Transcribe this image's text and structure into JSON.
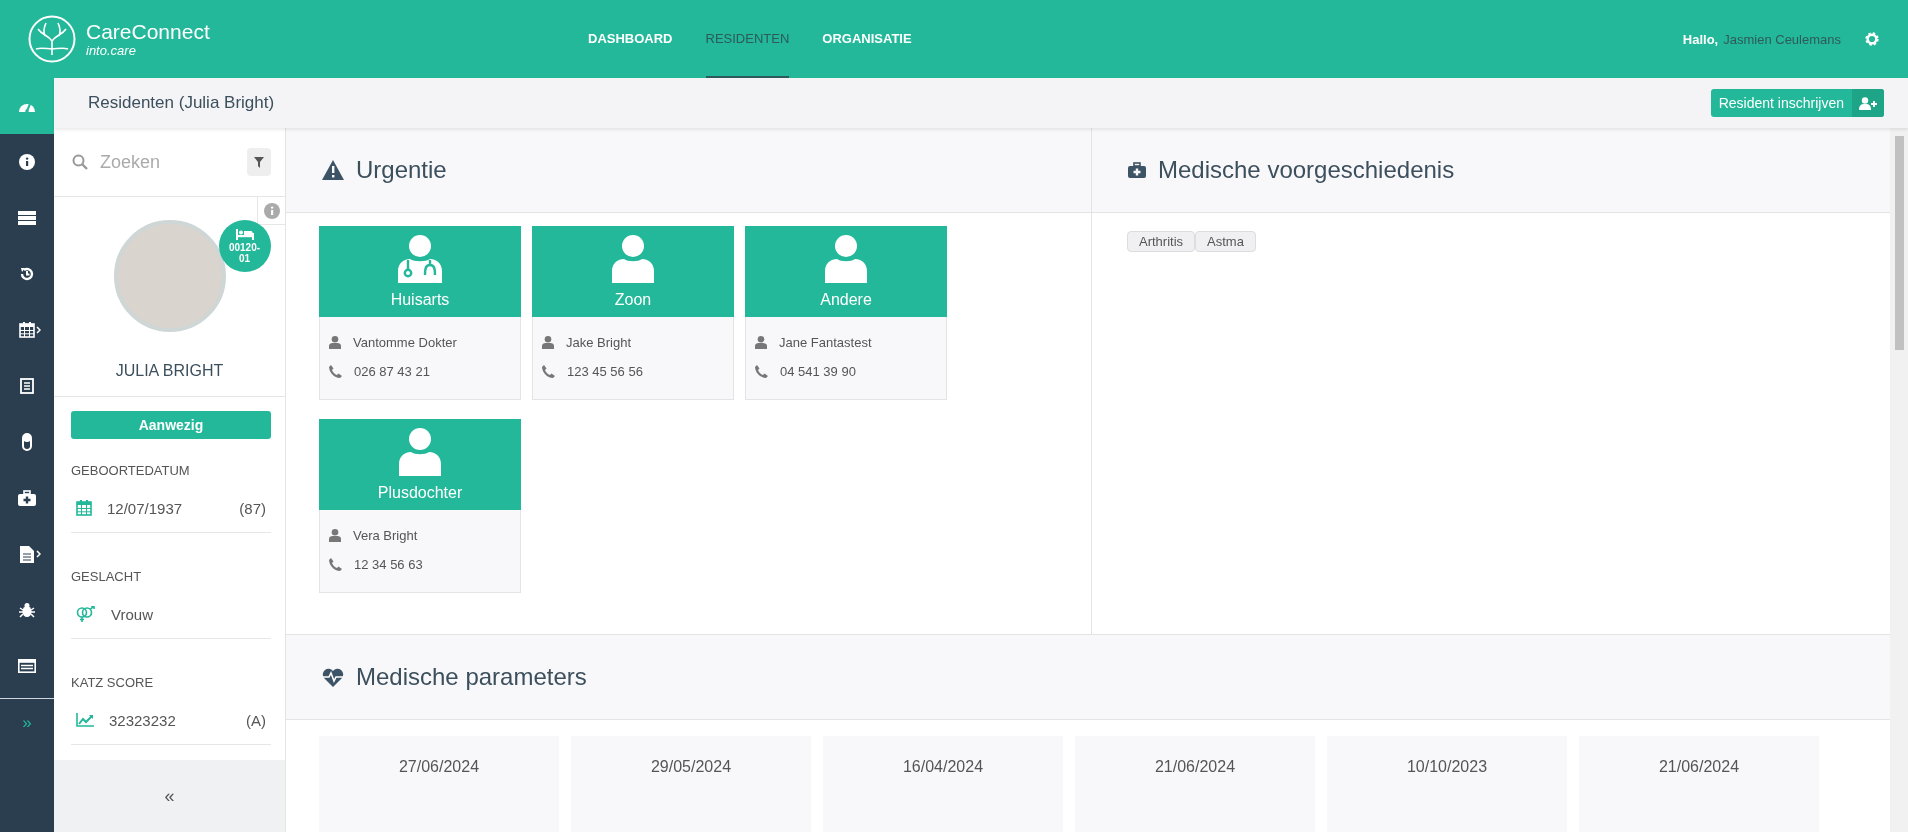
{
  "header": {
    "logo_title": "CareConnect",
    "logo_subtitle": "into.care",
    "nav": [
      {
        "label": "DASHBOARD",
        "selected": false
      },
      {
        "label": "RESIDENTEN",
        "selected": true
      },
      {
        "label": "ORGANISATIE",
        "selected": false
      }
    ],
    "greeting": "Hallo,",
    "user_name": "Jasmien Ceulemans"
  },
  "rail": {
    "items": [
      {
        "selected": true,
        "submenu": false
      },
      {
        "selected": false,
        "submenu": false
      },
      {
        "selected": false,
        "submenu": false
      },
      {
        "selected": false,
        "submenu": false
      },
      {
        "selected": false,
        "submenu": true
      },
      {
        "selected": false,
        "submenu": false
      },
      {
        "selected": false,
        "submenu": false
      },
      {
        "selected": false,
        "submenu": false
      },
      {
        "selected": false,
        "submenu": true
      },
      {
        "selected": false,
        "submenu": false
      },
      {
        "selected": false,
        "submenu": false
      }
    ],
    "expand": "»"
  },
  "page_title": "Residenten (Julia Bright)",
  "enroll_button": "Resident inschrijven",
  "resident": {
    "search": {
      "placeholder": "Zoeken"
    },
    "room_badge": "00120-01",
    "name": "JULIA BRIGHT",
    "status": "Aanwezig",
    "fields": [
      {
        "label": "GEBOORTEDATUM",
        "value": "12/07/1937",
        "extra": "(87)"
      },
      {
        "label": "GESLACHT",
        "value": "Vrouw"
      },
      {
        "label": "KATZ SCORE",
        "value": "32323232",
        "extra": "(A)"
      }
    ],
    "collapse": "«"
  },
  "urgency": {
    "title": "Urgentie",
    "contacts": [
      {
        "kind": "doctor",
        "role": "Huisarts",
        "name": "Vantomme Dokter",
        "phone": "026 87 43 21"
      },
      {
        "kind": "person",
        "role": "Zoon",
        "name": "Jake Bright",
        "phone": "123 45 56 56"
      },
      {
        "kind": "person",
        "role": "Andere",
        "name": "Jane Fantastest",
        "phone": "04 541 39 90"
      },
      {
        "kind": "person",
        "role": "Plusdochter",
        "name": "Vera Bright",
        "phone": "12 34 56 63"
      }
    ]
  },
  "history": {
    "title": "Medische voorgeschiedenis",
    "tags": [
      "Arthritis",
      "Astma"
    ]
  },
  "parameters": {
    "title": "Medische parameters",
    "dates": [
      "27/06/2024",
      "29/05/2024",
      "16/04/2024",
      "21/06/2024",
      "10/10/2023",
      "21/06/2024"
    ]
  }
}
